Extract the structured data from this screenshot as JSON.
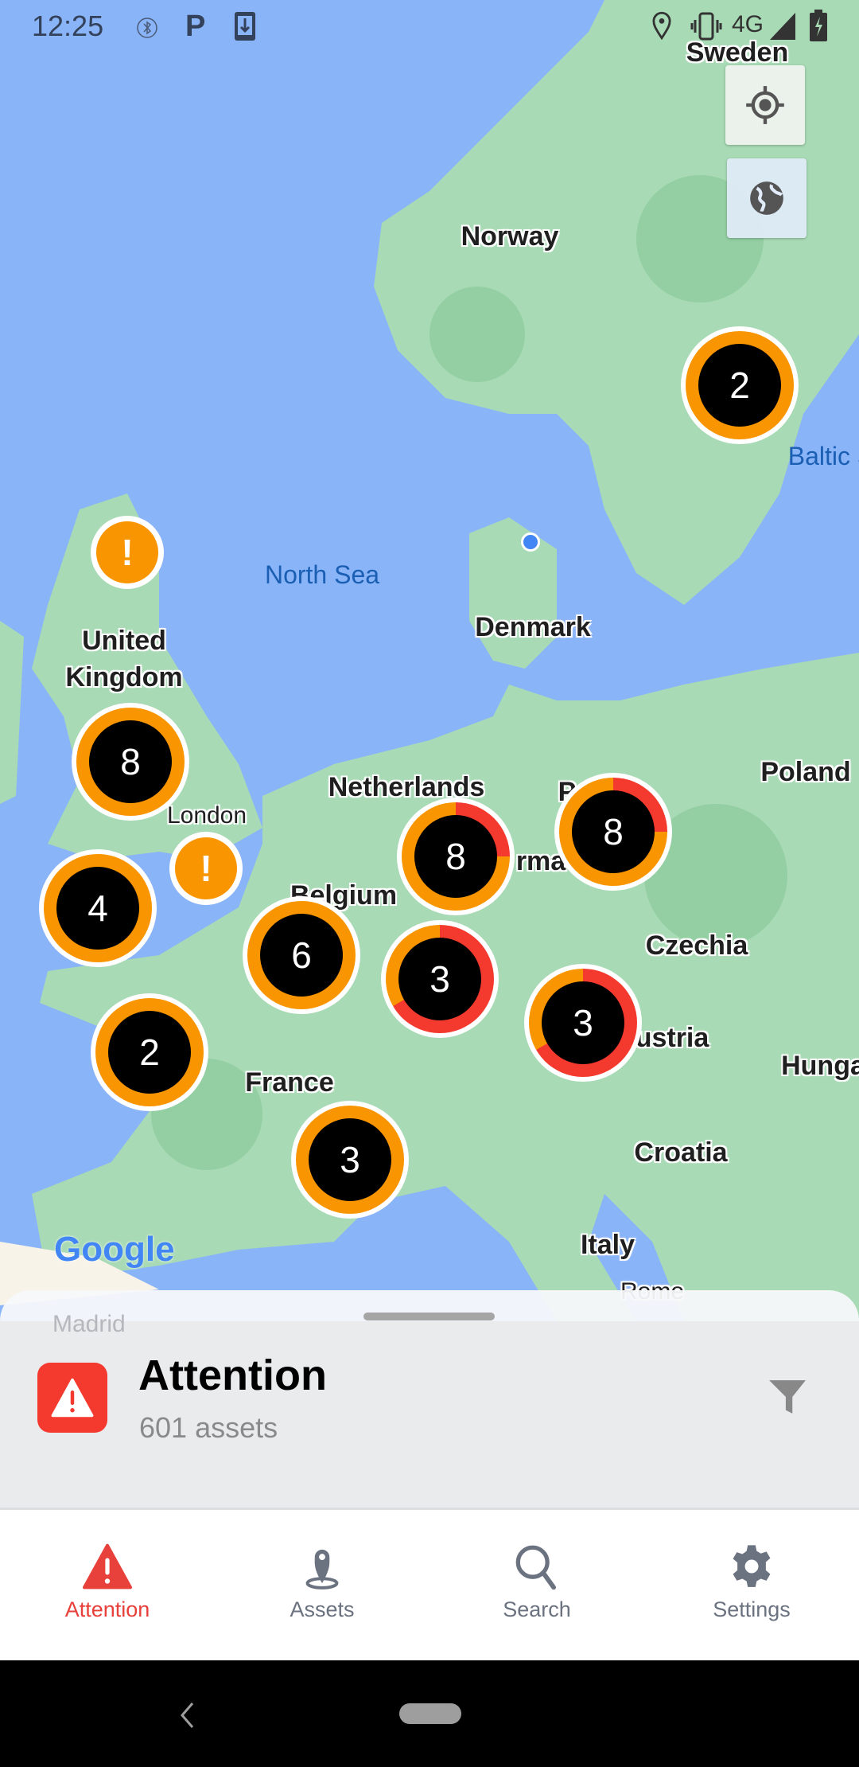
{
  "status_bar": {
    "time": "12:25",
    "network": "4G",
    "icons": [
      "bluetooth-icon",
      "parking-app-icon",
      "download-icon",
      "location-icon",
      "vibrate-icon",
      "signal-icon",
      "battery-charging-icon"
    ]
  },
  "map": {
    "labels": {
      "sweden": "Sweden",
      "norway": "Norway",
      "baltic": "Baltic S",
      "north_sea": "North Sea",
      "denmark": "Denmark",
      "uk_1": "United",
      "uk_2": "Kingdom",
      "netherlands": "Netherlands",
      "london": "London",
      "belgium": "Belgium",
      "germany": "rma",
      "poland": "Poland",
      "poland_partial": "P",
      "czechia": "Czechia",
      "austria": "ustria",
      "hungary": "Hunga",
      "france": "France",
      "croatia": "Croatia",
      "italy": "Italy",
      "rome": "Rome",
      "madrid": "Madrid"
    },
    "attribution": "Google",
    "clusters": [
      {
        "id": "sweden",
        "count": "2",
        "critical_fraction": 0
      },
      {
        "id": "uk",
        "count": "8",
        "critical_fraction": 0
      },
      {
        "id": "cornwall",
        "count": "4",
        "critical_fraction": 0
      },
      {
        "id": "brittany",
        "count": "2",
        "critical_fraction": 0
      },
      {
        "id": "paris",
        "count": "6",
        "critical_fraction": 0
      },
      {
        "id": "rhine",
        "count": "8",
        "critical_fraction": 0.25
      },
      {
        "id": "berlin",
        "count": "8",
        "critical_fraction": 0.25
      },
      {
        "id": "stuttgart",
        "count": "3",
        "critical_fraction": 0.6667
      },
      {
        "id": "munich",
        "count": "3",
        "critical_fraction": 0.6667
      },
      {
        "id": "lyon",
        "count": "3",
        "critical_fraction": 0
      }
    ],
    "single_alert_symbol": "!",
    "colors": {
      "warning": "#f99500",
      "critical": "#f4392e",
      "water": "#8ab4f8",
      "land": "#a8dab5"
    }
  },
  "sheet": {
    "title": "Attention",
    "subtitle": "601 assets",
    "icon": "warning-triangle-icon",
    "filter_icon": "filter-icon"
  },
  "nav": {
    "tabs": [
      {
        "label": "Attention",
        "active": true
      },
      {
        "label": "Assets"
      },
      {
        "label": "Search"
      },
      {
        "label": "Settings"
      }
    ],
    "active_color": "#e8403a"
  }
}
